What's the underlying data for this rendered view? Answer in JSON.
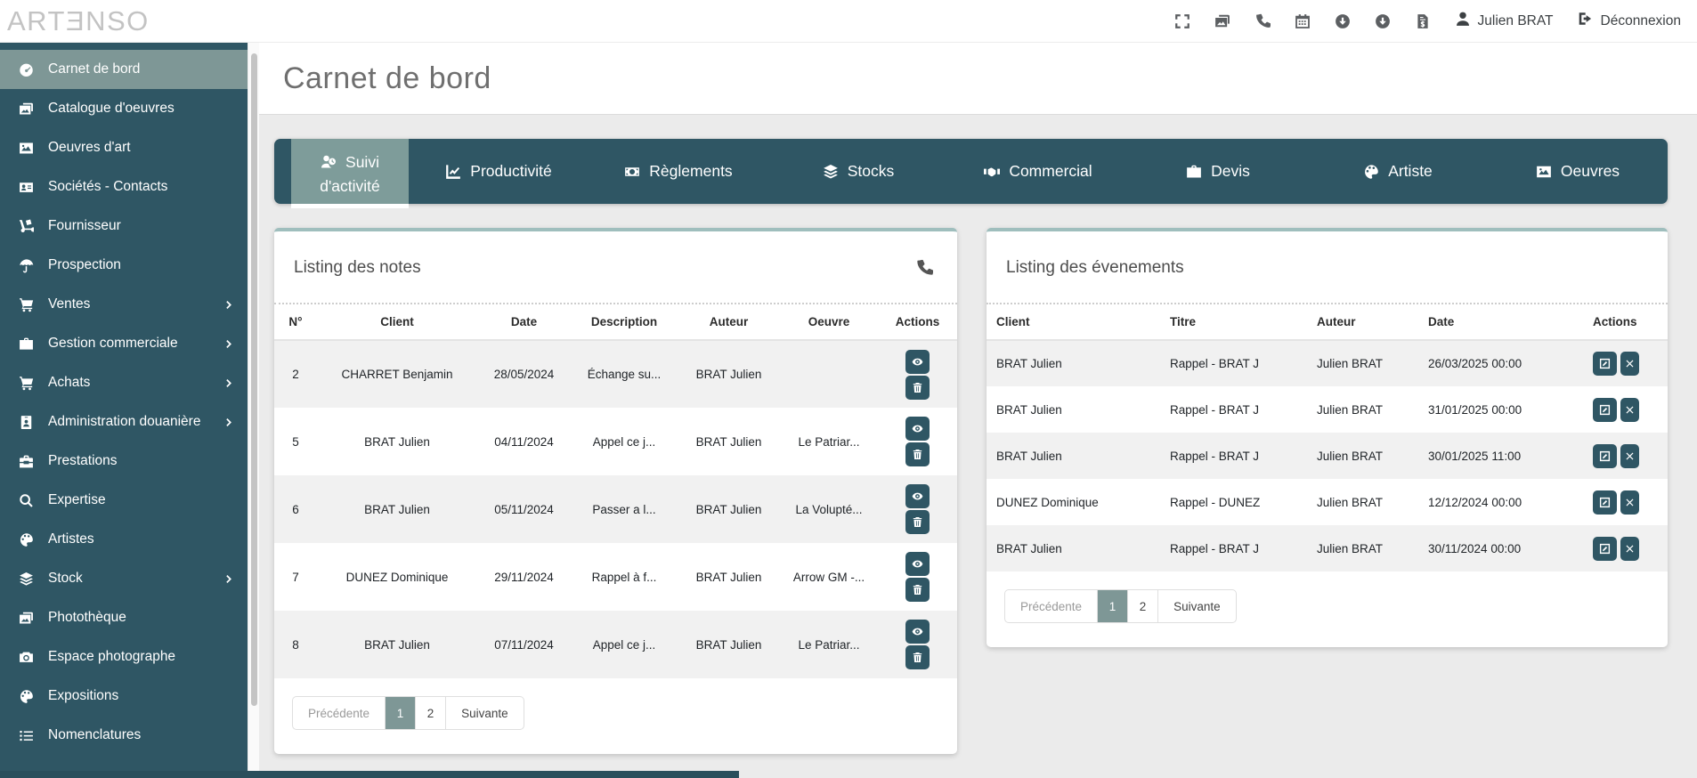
{
  "colors": {
    "sidebar_dark": "#2f5664",
    "accent_sage": "#7e9796",
    "panel_top_border": "#9fbebd",
    "content_bg": "#ebebeb"
  },
  "header": {
    "logo": "ARTƎNSO",
    "toolbar_icons": [
      "expand-icon",
      "images-icon",
      "phone-icon",
      "calendar-icon",
      "circle-down-icon",
      "circle-down-icon",
      "file-invoice-icon"
    ],
    "user_name": "Julien BRAT",
    "logout_label": "Déconnexion"
  },
  "sidebar": {
    "items": [
      {
        "label": "Carnet de bord",
        "icon": "gauge-icon",
        "active": true,
        "chevron": false
      },
      {
        "label": "Catalogue d'oeuvres",
        "icon": "images-icon",
        "chevron": false
      },
      {
        "label": "Oeuvres d'art",
        "icon": "image-icon",
        "chevron": false
      },
      {
        "label": "Sociétés - Contacts",
        "icon": "address-card-icon",
        "chevron": false
      },
      {
        "label": "Fournisseur",
        "icon": "dolly-icon",
        "chevron": false
      },
      {
        "label": "Prospection",
        "icon": "umbrella-icon",
        "chevron": false
      },
      {
        "label": "Ventes",
        "icon": "cart-icon",
        "chevron": true
      },
      {
        "label": "Gestion commerciale",
        "icon": "briefcase-icon",
        "chevron": true
      },
      {
        "label": "Achats",
        "icon": "cart-icon",
        "chevron": true
      },
      {
        "label": "Administration douanière",
        "icon": "id-badge-icon",
        "chevron": true
      },
      {
        "label": "Prestations",
        "icon": "toolbox-icon",
        "chevron": false
      },
      {
        "label": "Expertise",
        "icon": "search-icon",
        "chevron": false
      },
      {
        "label": "Artistes",
        "icon": "palette-icon",
        "chevron": false
      },
      {
        "label": "Stock",
        "icon": "layers-icon",
        "chevron": true
      },
      {
        "label": "Photothèque",
        "icon": "images-icon",
        "chevron": false
      },
      {
        "label": "Espace photographe",
        "icon": "camera-icon",
        "chevron": false
      },
      {
        "label": "Expositions",
        "icon": "palette-icon",
        "chevron": false
      },
      {
        "label": "Nomenclatures",
        "icon": "list-icon",
        "chevron": false
      }
    ]
  },
  "page": {
    "title": "Carnet de bord"
  },
  "tabs": [
    {
      "label": "Suivi d'activité",
      "icon": "user-clock-icon",
      "active": true
    },
    {
      "label": "Productivité",
      "icon": "chart-line-icon"
    },
    {
      "label": "Règlements",
      "icon": "money-bill-icon"
    },
    {
      "label": "Stocks",
      "icon": "layers-icon"
    },
    {
      "label": "Commercial",
      "icon": "handshake-icon"
    },
    {
      "label": "Devis",
      "icon": "briefcase-icon"
    },
    {
      "label": "Artiste",
      "icon": "palette-icon"
    },
    {
      "label": "Oeuvres",
      "icon": "image-icon"
    }
  ],
  "notes_panel": {
    "title": "Listing des notes",
    "header_icon": "phone-icon",
    "columns": [
      "N°",
      "Client",
      "Date",
      "Description",
      "Auteur",
      "Oeuvre",
      "Actions"
    ],
    "rows": [
      {
        "num": "2",
        "client": "CHARRET Benjamin",
        "date": "28/05/2024",
        "description": "Échange su...",
        "auteur": "BRAT Julien",
        "oeuvre": ""
      },
      {
        "num": "5",
        "client": "BRAT Julien",
        "date": "04/11/2024",
        "description": "Appel ce j...",
        "auteur": "BRAT Julien",
        "oeuvre": "Le Patriar..."
      },
      {
        "num": "6",
        "client": "BRAT Julien",
        "date": "05/11/2024",
        "description": "Passer a l...",
        "auteur": "BRAT Julien",
        "oeuvre": "La Volupté..."
      },
      {
        "num": "7",
        "client": "DUNEZ Dominique",
        "date": "29/11/2024",
        "description": "Rappel à f...",
        "auteur": "BRAT Julien",
        "oeuvre": "Arrow GM -..."
      },
      {
        "num": "8",
        "client": "BRAT Julien",
        "date": "07/11/2024",
        "description": "Appel ce j...",
        "auteur": "BRAT Julien",
        "oeuvre": "Le Patriar..."
      }
    ],
    "row_actions": [
      "view",
      "delete"
    ],
    "pagination": {
      "prev": "Précédente",
      "pages": [
        "1",
        "2"
      ],
      "active_page": "1",
      "next": "Suivante"
    }
  },
  "events_panel": {
    "title": "Listing des évenements",
    "columns": [
      "Client",
      "Titre",
      "Auteur",
      "Date",
      "Actions"
    ],
    "rows": [
      {
        "client": "BRAT Julien",
        "titre": "Rappel - BRAT J",
        "auteur": "Julien BRAT",
        "date": "26/03/2025 00:00"
      },
      {
        "client": "BRAT Julien",
        "titre": "Rappel - BRAT J",
        "auteur": "Julien BRAT",
        "date": "31/01/2025 00:00"
      },
      {
        "client": "BRAT Julien",
        "titre": "Rappel - BRAT J",
        "auteur": "Julien BRAT",
        "date": "30/01/2025 11:00"
      },
      {
        "client": "DUNEZ Dominique",
        "titre": "Rappel - DUNEZ",
        "auteur": "Julien BRAT",
        "date": "12/12/2024 00:00"
      },
      {
        "client": "BRAT Julien",
        "titre": "Rappel - BRAT J",
        "auteur": "Julien BRAT",
        "date": "30/11/2024 00:00"
      }
    ],
    "row_actions": [
      "edit",
      "remove"
    ],
    "pagination": {
      "prev": "Précédente",
      "pages": [
        "1",
        "2"
      ],
      "active_page": "1",
      "next": "Suivante"
    }
  }
}
